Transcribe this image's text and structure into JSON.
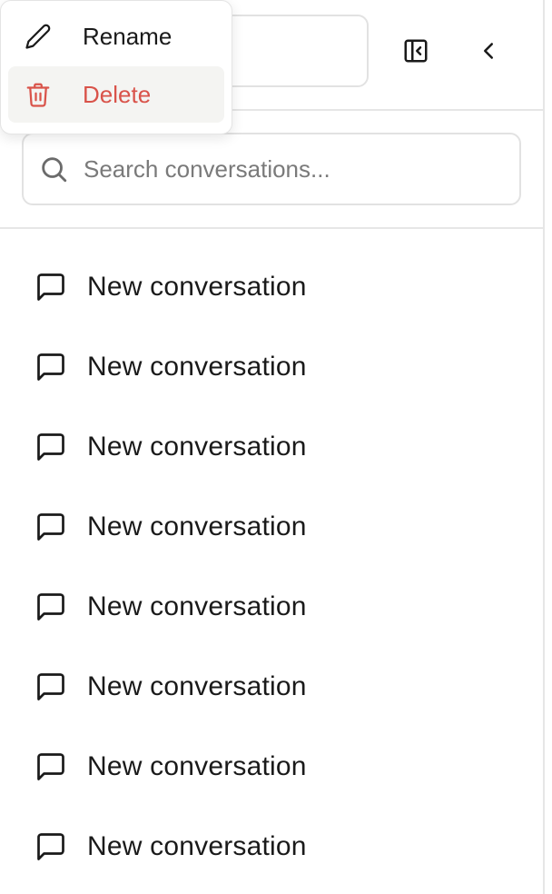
{
  "header": {
    "collapse_icon": "panel-collapse-icon",
    "back_icon": "chevron-left-icon"
  },
  "search": {
    "placeholder": "Search conversations...",
    "value": "",
    "icon": "search-icon"
  },
  "conversations": [
    {
      "label": "New conversation",
      "icon": "chat-bubble-icon"
    },
    {
      "label": "New conversation",
      "icon": "chat-bubble-icon"
    },
    {
      "label": "New conversation",
      "icon": "chat-bubble-icon"
    },
    {
      "label": "New conversation",
      "icon": "chat-bubble-icon"
    },
    {
      "label": "New conversation",
      "icon": "chat-bubble-icon"
    },
    {
      "label": "New conversation",
      "icon": "chat-bubble-icon"
    },
    {
      "label": "New conversation",
      "icon": "chat-bubble-icon"
    },
    {
      "label": "New conversation",
      "icon": "chat-bubble-icon"
    }
  ],
  "context_menu": {
    "rename_label": "Rename",
    "rename_icon": "pencil-icon",
    "delete_label": "Delete",
    "delete_icon": "trash-icon"
  },
  "colors": {
    "danger": "#d9534a",
    "border": "#e2e2e2",
    "text": "#1a1a1a",
    "placeholder": "#7a7a7a",
    "hover_bg": "#f4f4f2"
  }
}
